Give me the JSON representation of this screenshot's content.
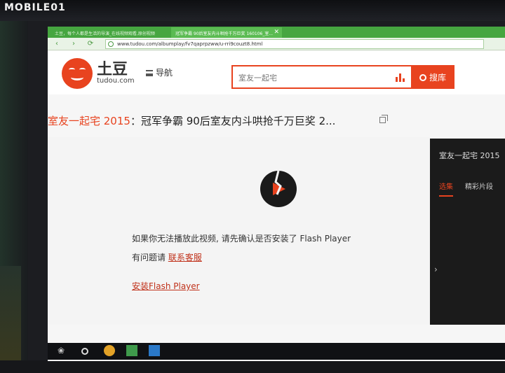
{
  "watermark": "MOBILE01",
  "browser": {
    "tabs": [
      {
        "label": "土豆，每个人都是生活的导演_在线视频观看,原创视频"
      },
      {
        "label": "冠军争霸 90后室友内斗哄抢千万巨奖 160106_室..."
      }
    ],
    "close_symbol": "✕",
    "back_symbol": "‹",
    "forward_symbol": "›",
    "url": "www.tudou.com/albumplay/fv7qaprpzww/u-rri9couzt8.html"
  },
  "site": {
    "logo_text": "土豆",
    "logo_sub": "tudou.com",
    "menu_label": "导航",
    "search_placeholder": "室友一起宅",
    "search_button": "搜库",
    "accent": "#e8431f"
  },
  "video": {
    "title_highlight": "室友一起宅 2015",
    "title_rest": "：冠军争霸 90后室友内斗哄抢千万巨奖 2..."
  },
  "player": {
    "message_line1": "如果你无法播放此视频, 请先确认是否安装了 Flash Player",
    "message_line2_prefix": "有问题请 ",
    "contact_link": "联系客服",
    "install_link": "安装Flash Player"
  },
  "side_panel": {
    "title": "室友一起宅 2015",
    "tabs": [
      {
        "label": "选集"
      },
      {
        "label": "精彩片段"
      }
    ],
    "arrow": "›"
  },
  "taskbar": {
    "icons": [
      "windows-logo-icon",
      "cortana-circle-icon",
      "app-orange-icon",
      "app-green-icon",
      "app-blue-icon"
    ]
  }
}
